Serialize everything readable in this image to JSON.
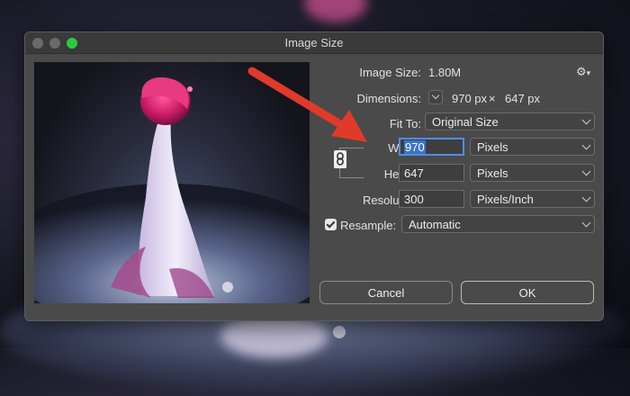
{
  "dialog": {
    "title": "Image Size"
  },
  "image_size": {
    "label": "Image Size:",
    "value": "1.80M"
  },
  "dimensions": {
    "label": "Dimensions:",
    "width": "970 px",
    "times": "×",
    "height": "647 px"
  },
  "fit_to": {
    "label": "Fit To:",
    "value": "Original Size"
  },
  "width": {
    "label": "Width:",
    "value": "970",
    "unit": "Pixels"
  },
  "height": {
    "label": "Height:",
    "value": "647",
    "unit": "Pixels"
  },
  "resolution": {
    "label": "Resolution:",
    "value": "300",
    "unit": "Pixels/Inch"
  },
  "resample": {
    "label": "Resample:",
    "value": "Automatic",
    "checked": true
  },
  "buttons": {
    "cancel": "Cancel",
    "ok": "OK"
  },
  "colors": {
    "annotation_arrow": "#e03a2a",
    "focus": "#4f8ee8",
    "zoom_button": "#2fc840"
  },
  "icons": [
    "gear-icon",
    "chain-link-icon",
    "chevron-down-icon",
    "checkbox-checked-icon"
  ]
}
